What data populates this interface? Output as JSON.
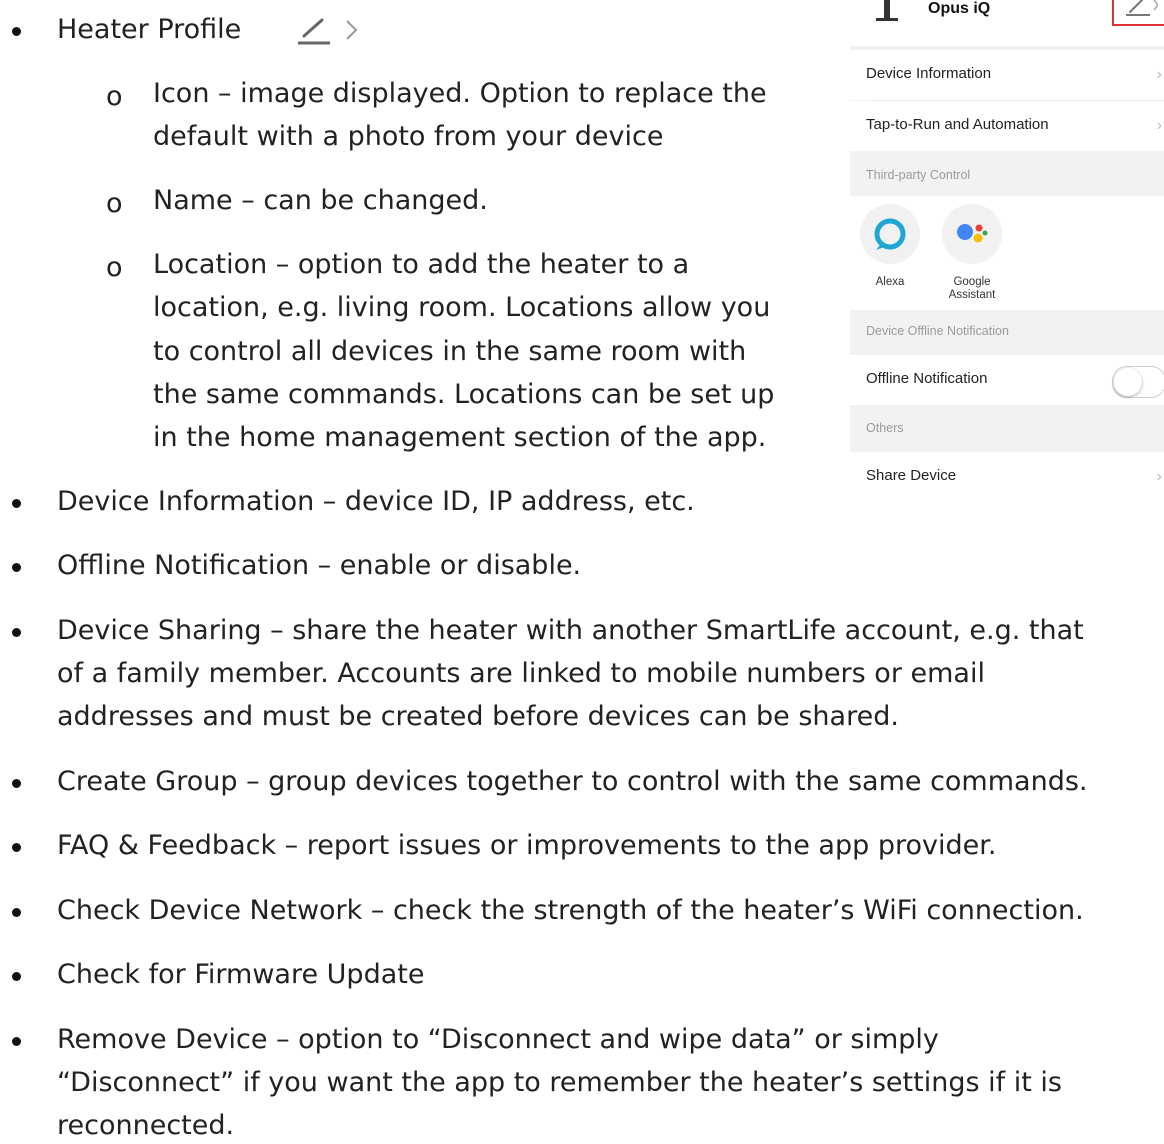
{
  "main_list": [
    "Heater Profile",
    "Device Information – device ID, IP address, etc.",
    "Offline Notification – enable or disable.",
    "Device Sharing – share the heater with another SmartLife account, e.g. that",
    "of a family member. Accounts are linked to mobile numbers or email",
    "addresses and must be created before devices can be shared.",
    "Create Group – group devices together to control with the same commands.",
    "FAQ & Feedback – report issues or improvements to the app provider.",
    "Check Device Network – check the strength of the heater’s WiFi connection.",
    "Check for Firmware Update",
    "Remove Device – option to “Disconnect and wipe data” or simply",
    "“Disconnect” if you want the app to remember the heater’s settings if it is",
    "reconnected."
  ],
  "sub_list": [
    "Icon – image displayed. Option to replace the",
    "default with a photo from your device",
    "Name – can be changed.",
    "Location – option to add the heater to a",
    "location, e.g. living room. Locations allow you",
    "to control all devices in the same room with",
    "the same commands. Locations can be set up",
    "in the home management section of the app."
  ],
  "sub_bullet_glyph": "o",
  "icons": {
    "heading_edit": "pencil-icon",
    "heading_chevron": "chevron-right-icon",
    "phone_header_edit": "pencil-icon"
  },
  "phone": {
    "title": "Opus iQ",
    "rows": {
      "device_information": "Device Information",
      "tap_to_run": "Tap-to-Run and Automation",
      "offline_notification": "Offline Notification",
      "share_device": "Share Device"
    },
    "sections": {
      "third_party": "Third-party Control",
      "offline": "Device Offline Notification",
      "others": "Others"
    },
    "third_party": {
      "alexa": "Alexa",
      "google_line1": "Google",
      "google_line2": "Assistant"
    },
    "offline_notification_enabled": false,
    "chevron": "›"
  },
  "colors": {
    "alexa": "#1ea7d3",
    "google_blue": "#4285f4",
    "google_red": "#ea4335",
    "google_yellow": "#fbbc05",
    "google_green": "#34a853",
    "highlight": "#dd3333"
  }
}
